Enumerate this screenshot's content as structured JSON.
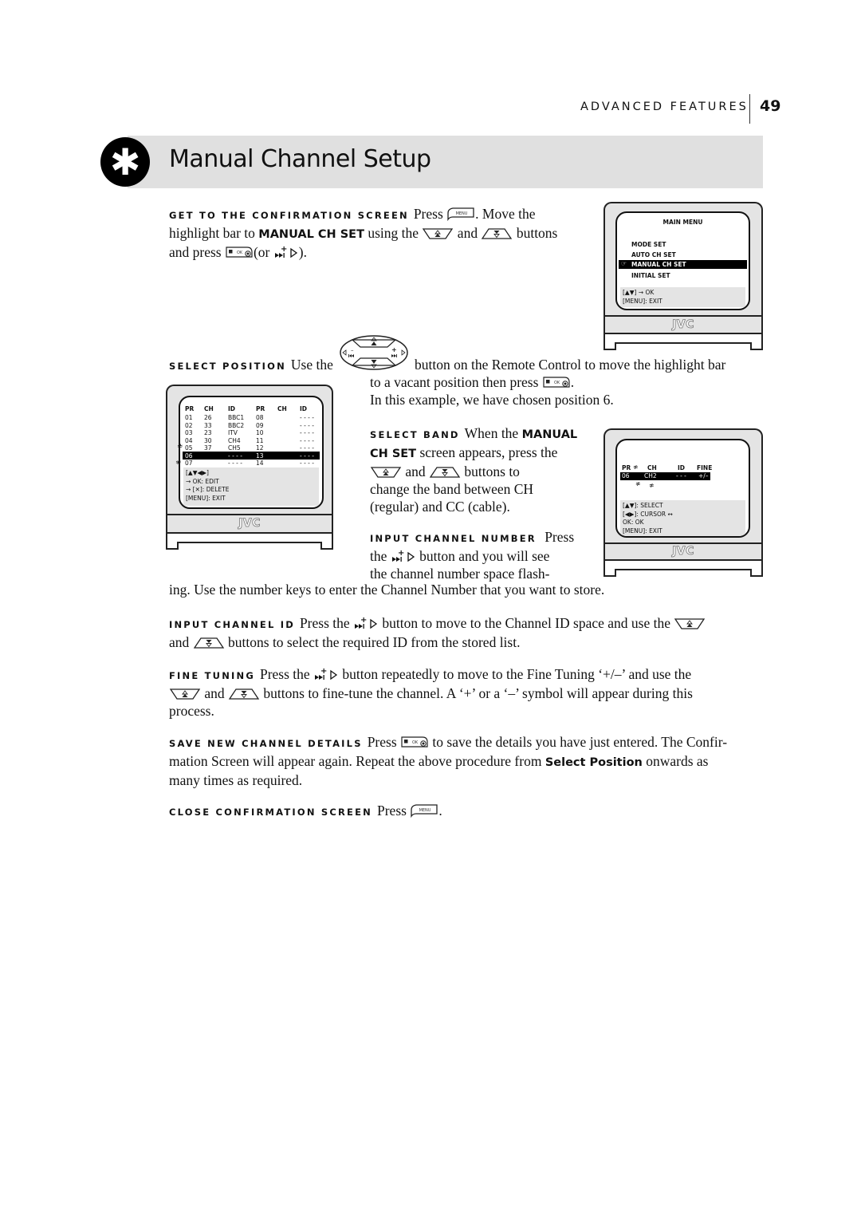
{
  "header": {
    "section": "ADVANCED FEATURES",
    "page_number": "49"
  },
  "title": {
    "badge_icon": "asterisk-icon",
    "badge_glyph": "✱",
    "text": "Manual Channel Setup"
  },
  "sections": {
    "confirm": {
      "lead": "GET TO THE CONFIRMATION SCREEN",
      "t1": "Press",
      "t2": ". Move the",
      "t3": "highlight bar to",
      "kw": "MANUAL CH SET",
      "t4": "using the",
      "t5": "and",
      "t6": "buttons",
      "t7": "and press",
      "t8": "(or",
      "t9": ")."
    },
    "select_position": {
      "lead": "SELECT POSITION",
      "t1": "Use the",
      "t2": "button on the Remote Control to move the highlight bar",
      "t3": "to a vacant position then press",
      "t4": ".",
      "t5": "In this example, we have chosen position 6."
    },
    "select_band": {
      "lead": "SELECT BAND",
      "t1": "When the",
      "kw1": "MANUAL",
      "kw2": "CH SET",
      "t2": "screen appears, press the",
      "t3": "and",
      "t4": "buttons to",
      "t5": "change the band between CH",
      "t6": "(regular) and CC (cable)."
    },
    "input_channel_number": {
      "lead": "INPUT CHANNEL NUMBER",
      "t1": "Press",
      "t2": "the",
      "t3": "button and you will see",
      "t4": "the channel number space flash-",
      "t5": "ing. Use the number keys to enter the Channel Number that you want to store."
    },
    "input_channel_id": {
      "lead": "INPUT CHANNEL ID",
      "t1": "Press the",
      "t2": "button to move to the Channel ID space and use the",
      "t3": "and",
      "t4": "buttons to select the required ID from the stored list."
    },
    "fine_tuning": {
      "lead": "FINE TUNING",
      "t1": "Press the",
      "t2": "button repeatedly to move to the Fine Tuning ‘+/–’ and use the",
      "t3": "and",
      "t4": "buttons to fine-tune the channel. A ‘+’ or a ‘–’ symbol will appear during this",
      "t5": "process."
    },
    "save": {
      "lead": "SAVE NEW CHANNEL DETAILS",
      "t1": "Press",
      "t2": "to save the details you have just entered.  The Confir-",
      "t3": "mation Screen will appear again. Repeat the above procedure from",
      "kw": "Select Position",
      "t4": "onwards as",
      "t5": "many times as required."
    },
    "close": {
      "lead": "CLOSE CONFIRMATION SCREEN",
      "t1": "Press",
      "t2": "."
    }
  },
  "icons": {
    "menu_key": "MENU",
    "ok_key": "OK"
  },
  "tv_main_menu": {
    "title": "MAIN MENU",
    "items": [
      "MODE SET",
      "AUTO CH SET",
      "MANUAL CH SET",
      "INITIAL SET"
    ],
    "selected_index": 2,
    "help": [
      "[▲▼] → OK",
      "[MENU]: EXIT"
    ],
    "logo": "JVC"
  },
  "tv_confirmation": {
    "headers": [
      "PR",
      "CH",
      "ID",
      "PR",
      "CH",
      "ID"
    ],
    "rows": [
      {
        "pr": "01",
        "ch": "26",
        "id": "BBC1",
        "pr2": "08",
        "ch2": "",
        "id2": "- - - -"
      },
      {
        "pr": "02",
        "ch": "33",
        "id": "BBC2",
        "pr2": "09",
        "ch2": "",
        "id2": "- - - -"
      },
      {
        "pr": "03",
        "ch": "23",
        "id": "ITV",
        "pr2": "10",
        "ch2": "",
        "id2": "- - - -"
      },
      {
        "pr": "04",
        "ch": "30",
        "id": "CH4",
        "pr2": "11",
        "ch2": "",
        "id2": "- - - -"
      },
      {
        "pr": "05",
        "ch": "37",
        "id": "CH5",
        "pr2": "12",
        "ch2": "",
        "id2": "- - - -"
      },
      {
        "pr": "06",
        "ch": "",
        "id": "- - - -",
        "pr2": "13",
        "ch2": "",
        "id2": "- - - -"
      },
      {
        "pr": "07",
        "ch": "",
        "id": "- - - -",
        "pr2": "14",
        "ch2": "",
        "id2": "- - - -"
      }
    ],
    "selected_index": 5,
    "help": [
      "[▲▼◀▶]",
      "→ OK: EDIT",
      "→ [✕]: DELETE",
      "[MENU]: EXIT"
    ],
    "logo": "JVC"
  },
  "tv_manual_set": {
    "headers": [
      "PR",
      "CH",
      "ID",
      "FINE"
    ],
    "row": {
      "pr": "06",
      "ch": "CH2",
      "id": "- - -",
      "fine": "+/–"
    },
    "help": [
      "[▲▼]: SELECT",
      "[◀▶]: CURSOR ↔",
      "OK: OK",
      "[MENU]: EXIT"
    ],
    "logo": "JVC"
  }
}
